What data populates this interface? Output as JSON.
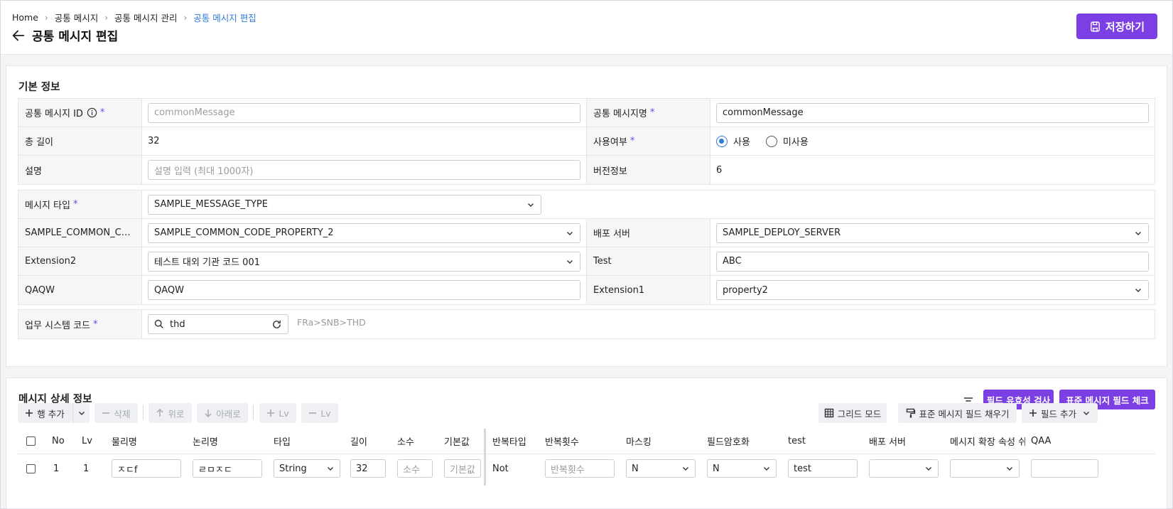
{
  "breadcrumb": [
    "Home",
    "공통 메시지",
    "공통 메시지 관리",
    "공통 메시지 편집"
  ],
  "page_title": "공통 메시지 편집",
  "save_label": "저장하기",
  "basic": {
    "title": "기본 정보",
    "id_label": "공통 메시지 ID",
    "id_placeholder": "commonMessage",
    "name_label": "공통 메시지명",
    "name_value": "commonMessage",
    "total_len_label": "총 길이",
    "total_len_value": "32",
    "use_label": "사용여부",
    "use_opt": "사용",
    "unuse_opt": "미사용",
    "desc_label": "설명",
    "desc_placeholder": "설명 입력 (최대 1000자)",
    "version_label": "버전정보",
    "version_value": "6",
    "msgtype_label": "메시지 타입",
    "msgtype_value": "SAMPLE_MESSAGE_TYPE",
    "sample_label": "SAMPLE_COMMON_C…",
    "sample_value": "SAMPLE_COMMON_CODE_PROPERTY_2",
    "deploy_label": "배포 서버",
    "deploy_value": "SAMPLE_DEPLOY_SERVER",
    "ext2_label": "Extension2",
    "ext2_value": "테스트 대외 기관 코드 001",
    "test_label": "Test",
    "test_value": "ABC",
    "qaqw_label": "QAQW",
    "qaqw_value": "QAQW",
    "ext1_label": "Extension1",
    "ext1_value": "property2",
    "bizcode_label": "업무 시스템 코드",
    "bizcode_value": "thd",
    "bizcode_path": "FRa>SNB>THD",
    "required_mark": "*"
  },
  "detail": {
    "title": "메시지 상세 정보",
    "validate_label": "필드 유효성 검사",
    "stdcheck_label": "표준 메시지 필드 체크",
    "add_row": "행 추가",
    "delete": "삭제",
    "up": "위로",
    "down": "아래로",
    "lv_plus": "Lv",
    "lv_minus": "Lv",
    "grid_mode": "그리드 모드",
    "fill_std": "표준 메시지 필드 채우기",
    "add_field": "필드 추가",
    "columns": [
      "No",
      "Lv",
      "물리명",
      "논리명",
      "타입",
      "길이",
      "소수",
      "기본값",
      "반복타입",
      "반복횟수",
      "마스킹",
      "필드암호화",
      "test",
      "배포 서버",
      "메시지 확장 속성 쉬",
      "QAA"
    ],
    "row": {
      "no": "1",
      "lv": "1",
      "physical": "ㅈㄷf",
      "logical": "ㄹㅁㅈㄷ",
      "type": "String",
      "length": "32",
      "decimal_ph": "소수",
      "default_ph": "기본값",
      "repeat_type": "Not",
      "repeat_count_ph": "반복횟수",
      "masking": "N",
      "encrypt": "N",
      "test": "test"
    }
  },
  "colors": {
    "accent": "#7b3fe4",
    "link": "#2f7ad6"
  }
}
